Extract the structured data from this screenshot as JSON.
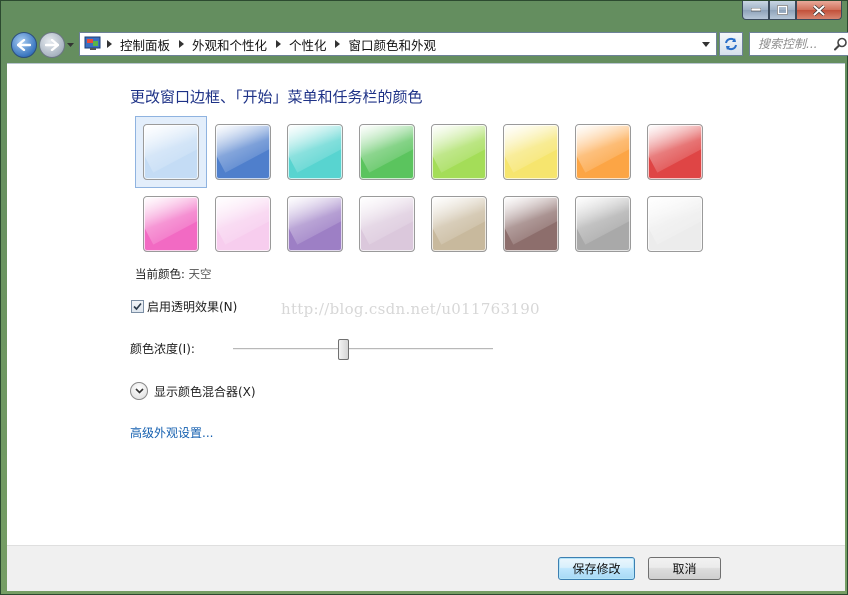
{
  "window": {
    "controls": {
      "minimize": "minimize",
      "maximize": "maximize",
      "close": "close"
    }
  },
  "nav": {
    "breadcrumbs": [
      "控制面板",
      "外观和个性化",
      "个性化",
      "窗口颜色和外观"
    ],
    "search_placeholder": "搜索控制..."
  },
  "main": {
    "heading": "更改窗口边框、「开始」菜单和任务栏的颜色",
    "swatches": [
      {
        "color": "#c4dcf5",
        "selected": true
      },
      {
        "color": "#4f7fcc"
      },
      {
        "color": "#58d4d0"
      },
      {
        "color": "#5bc45e"
      },
      {
        "color": "#a4dd58"
      },
      {
        "color": "#f6e56e"
      },
      {
        "color": "#fca545"
      },
      {
        "color": "#df4545"
      },
      {
        "color": "#f26ac3"
      },
      {
        "color": "#f7cdee"
      },
      {
        "color": "#9d7fc5"
      },
      {
        "color": "#dbc8dc"
      },
      {
        "color": "#c8b99d"
      },
      {
        "color": "#8d6e6c"
      },
      {
        "color": "#a9a9a9"
      },
      {
        "color": "#ececec"
      }
    ],
    "current_color_label": "当前颜色:",
    "current_color_value": "天空",
    "transparency_label": "启用透明效果(N)",
    "transparency_checked": true,
    "intensity_label": "颜色浓度(I):",
    "intensity_value": 0.42,
    "mixer_label": "显示颜色混合器(X)",
    "advanced_link": "高级外观设置...",
    "watermark": "http://blog.csdn.net/u011763190"
  },
  "footer": {
    "save_label": "保存修改",
    "cancel_label": "取消"
  }
}
